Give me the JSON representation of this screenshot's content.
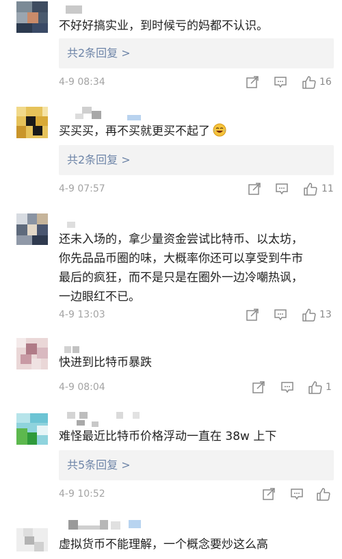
{
  "comments": [
    {
      "text": "不好好搞实业，到时候亏的妈都不认识。",
      "reply_label": "共2条回复 >",
      "time": "4-9 08:34",
      "likes": "16",
      "emoji": null
    },
    {
      "text": "买买买，再不买就更买不起了",
      "reply_label": "共2条回复 >",
      "time": "4-9 07:57",
      "likes": "11",
      "emoji": "laughing-tears"
    },
    {
      "text_lines": [
        "还未入场的，拿少量资金尝试比特币、以太坊，",
        "你先品品币圈的味，大概率你还可以享受到牛市",
        "最后的疯狂，而不是只是在圈外一边冷嘲热讽，",
        "一边眼红不已。"
      ],
      "reply_label": null,
      "time": "4-9 13:03",
      "likes": "13"
    },
    {
      "text": "快进到比特币暴跌",
      "reply_label": null,
      "time": "4-9 08:04",
      "likes": "1"
    },
    {
      "text": "难怪最近比特币价格浮动一直在 38w 上下",
      "reply_label": "共5条回复 >",
      "time": "4-9 10:52",
      "likes": ""
    },
    {
      "text": "虚拟货币不能理解，一个概念要炒这么高",
      "reply_label": null,
      "time": null,
      "likes": null
    }
  ],
  "icons": {
    "share": "share-icon",
    "comment": "comment-icon",
    "like": "thumbs-up-icon"
  },
  "colors": {
    "reply_link": "#6e85a8",
    "reply_bg": "#f3f3f3",
    "meta": "#a3a3a3"
  }
}
